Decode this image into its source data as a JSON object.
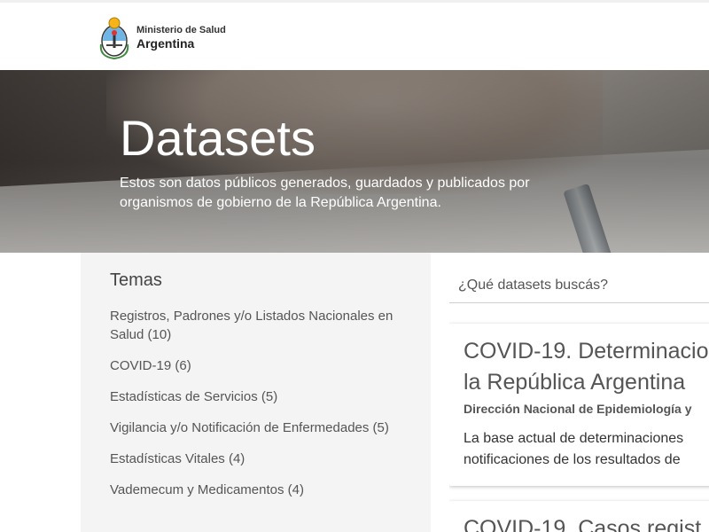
{
  "header": {
    "logo_subtitle": "Ministerio de Salud",
    "logo_title": "Argentina"
  },
  "hero": {
    "title": "Datasets",
    "description": "Estos son datos públicos generados, guardados y publicados por organismos de gobierno de la República Argentina."
  },
  "sidebar": {
    "title": "Temas",
    "topics": [
      {
        "label": "Registros, Padrones y/o Listados Nacionales en Salud (10)"
      },
      {
        "label": "COVID-19 (6)"
      },
      {
        "label": "Estadísticas de Servicios (5)"
      },
      {
        "label": "Vigilancia y/o Notificación de Enfermedades (5)"
      },
      {
        "label": "Estadísticas Vitales (4)"
      },
      {
        "label": "Vademecum y Medicamentos (4)"
      }
    ]
  },
  "search": {
    "placeholder": "¿Qué datasets buscás?"
  },
  "results": [
    {
      "title": "COVID-19. Determinacio\nla República Argentina",
      "organization": "Dirección Nacional de Epidemiología y",
      "description": "La base actual de determinaciones\nnotificaciones de los resultados de"
    },
    {
      "title": "COVID-19. Casos regist"
    }
  ],
  "colors": {
    "sidebar_bg": "#f4f4f4",
    "text_gray": "#555555",
    "hero_text": "#ffffff"
  }
}
